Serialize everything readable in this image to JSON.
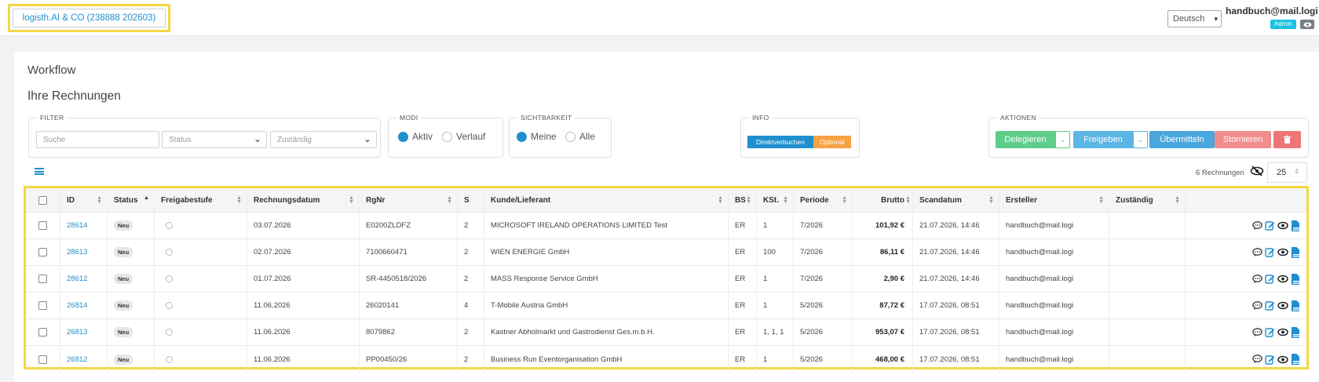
{
  "header": {
    "company_button": "logisth.AI & CO (238888 202603)",
    "language": "Deutsch",
    "user_email": "handbuch@mail.logi",
    "role_badge": "Admin"
  },
  "page": {
    "title": "Workflow",
    "subtitle": "Ihre Rechnungen"
  },
  "filter": {
    "legend": "FILTER",
    "search_placeholder": "Suche",
    "status_placeholder": "Status",
    "assignee_placeholder": "Zuständig"
  },
  "modi": {
    "legend": "MODI",
    "options": [
      "Aktiv",
      "Verlauf"
    ],
    "selected": "Aktiv"
  },
  "visibility": {
    "legend": "SICHTBARKEIT",
    "options": [
      "Meine",
      "Alle"
    ],
    "selected": "Meine"
  },
  "info": {
    "legend": "INFO",
    "badge_direct": "Direktverbuchen",
    "badge_optional": "Optional"
  },
  "actions": {
    "legend": "AKTIONEN",
    "delegate": "Delegieren",
    "release": "Freigeben",
    "transmit": "Übermitteln",
    "cancel": "Stornieren"
  },
  "table_meta": {
    "count_text": "6 Rechnungen",
    "page_size": "25"
  },
  "colors": {
    "accent": "#1f8fce",
    "delegate": "#5fcd8a",
    "release": "#5bb6e4",
    "transmit": "#48a7dd",
    "cancel": "#f08c8c",
    "delete": "#ef7676",
    "optional": "#f6a342"
  },
  "table": {
    "columns": [
      "ID",
      "Status",
      "Freigabestufe",
      "Rechnungsdatum",
      "RgNr",
      "S",
      "Kunde/Lieferant",
      "BS",
      "KSt.",
      "Periode",
      "Brutto",
      "Scandatum",
      "Ersteller",
      "Zuständig"
    ],
    "rows": [
      {
        "id": "28614",
        "status": "Neu",
        "date": "03.07.2026",
        "rgnr": "E0200ZLDFZ",
        "s": "2",
        "vendor": "MICROSOFT IRELAND OPERATIONS LIMITED Test",
        "bs": "ER",
        "kst": "1",
        "period": "7/2026",
        "gross": "101,92 €",
        "scan": "21.07.2026, 14:46",
        "creator": "handbuch@mail.logi",
        "assignee": ""
      },
      {
        "id": "28613",
        "status": "Neu",
        "date": "02.07.2026",
        "rgnr": "7100660471",
        "s": "2",
        "vendor": "WIEN ENERGIE GmbH",
        "bs": "ER",
        "kst": "100",
        "period": "7/2026",
        "gross": "86,11 €",
        "scan": "21.07.2026, 14:46",
        "creator": "handbuch@mail.logi",
        "assignee": ""
      },
      {
        "id": "28612",
        "status": "Neu",
        "date": "01.07.2026",
        "rgnr": "SR-4450518/2026",
        "s": "2",
        "vendor": "MASS Response Service GmbH",
        "bs": "ER",
        "kst": "1",
        "period": "7/2026",
        "gross": "2,90 €",
        "scan": "21.07.2026, 14:46",
        "creator": "handbuch@mail.logi",
        "assignee": ""
      },
      {
        "id": "26814",
        "status": "Neu",
        "date": "11.06.2026",
        "rgnr": "26020141",
        "s": "4",
        "vendor": "T-Mobile Austria GmbH",
        "bs": "ER",
        "kst": "1",
        "period": "5/2026",
        "gross": "87,72 €",
        "scan": "17.07.2026, 08:51",
        "creator": "handbuch@mail.logi",
        "assignee": ""
      },
      {
        "id": "26813",
        "status": "Neu",
        "date": "11.06.2026",
        "rgnr": "8079862",
        "s": "2",
        "vendor": "Kastner Abholmarkt und Gastrodienst Ges.m.b.H.",
        "bs": "ER",
        "kst": "1, 1, 1",
        "period": "5/2026",
        "gross": "953,07 €",
        "scan": "17.07.2026, 08:51",
        "creator": "handbuch@mail.logi",
        "assignee": ""
      },
      {
        "id": "26812",
        "status": "Neu",
        "date": "11.06.2026",
        "rgnr": "PP00450/26",
        "s": "2",
        "vendor": "Business Run Eventorganisation GmbH",
        "bs": "ER",
        "kst": "1",
        "period": "5/2026",
        "gross": "468,00 €",
        "scan": "17.07.2026, 08:51",
        "creator": "handbuch@mail.logi",
        "assignee": ""
      }
    ]
  }
}
